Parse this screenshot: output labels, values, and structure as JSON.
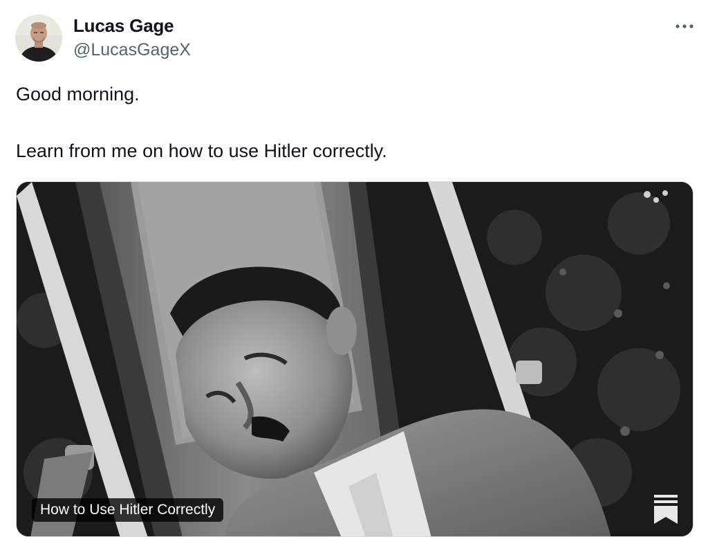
{
  "author": {
    "name": "Lucas Gage",
    "handle": "@LucasGageX",
    "avatar_icon": "profile-photo"
  },
  "more_icon": "ellipsis-icon",
  "tweet": {
    "lines": [
      "Good morning.",
      "Learn from me on how to use Hitler correctly."
    ]
  },
  "media_card": {
    "caption": "How to Use Hitler Correctly",
    "logo_icon": "substack-bookmark-icon",
    "image_style": "black-and-white photograph"
  },
  "colors": {
    "text": "#0f1419",
    "secondary_text": "#536471",
    "card_border": "#cfd9de"
  }
}
